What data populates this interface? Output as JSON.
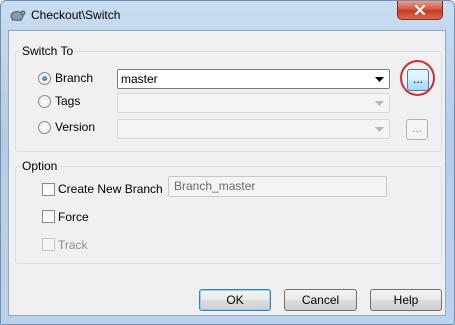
{
  "window": {
    "title": "Checkout\\Switch"
  },
  "switch_to": {
    "legend": "Switch To",
    "branch": {
      "label": "Branch",
      "selected": true,
      "value": "master"
    },
    "tags": {
      "label": "Tags",
      "selected": false,
      "value": ""
    },
    "version": {
      "label": "Version",
      "selected": false,
      "value": ""
    },
    "browse_label": "..."
  },
  "option": {
    "legend": "Option",
    "create_new_branch": {
      "label": "Create New Branch",
      "checked": false,
      "value": "Branch_master"
    },
    "force": {
      "label": "Force",
      "checked": false
    },
    "track": {
      "label": "Track",
      "checked": false,
      "disabled": true
    }
  },
  "buttons": {
    "ok": "OK",
    "cancel": "Cancel",
    "help": "Help"
  },
  "icons": {
    "app": "tortoise-icon",
    "close": "close-icon",
    "dropdown": "chevron-down-icon"
  },
  "colors": {
    "accent": "#3c7fb1",
    "close": "#c23a22",
    "highlight": "#d7282f"
  }
}
